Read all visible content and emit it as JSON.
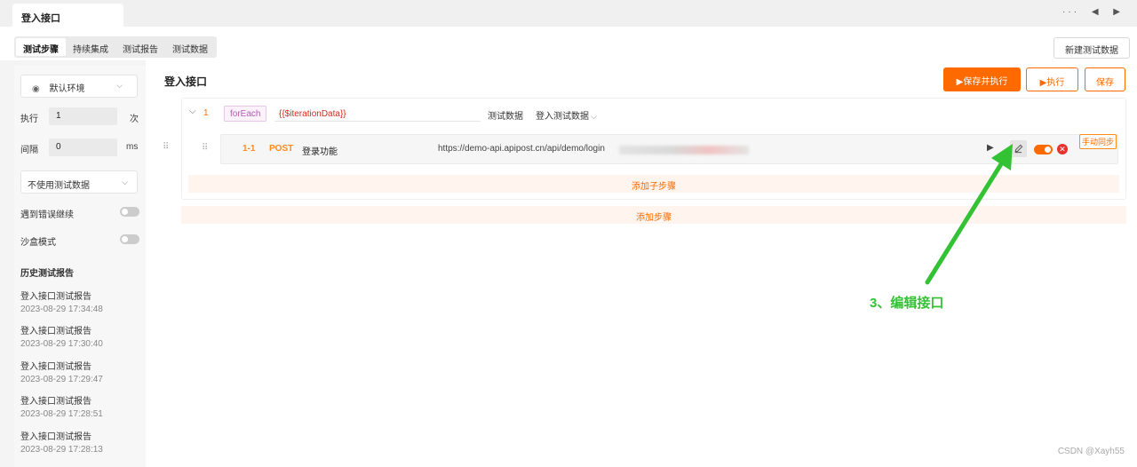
{
  "window_tab": {
    "title": "登入接口"
  },
  "tab_controls": {
    "more": "···",
    "prev": "◀",
    "next": "▶"
  },
  "subtabs": [
    {
      "label": "测试步骤",
      "active": true
    },
    {
      "label": "持续集成",
      "active": false
    },
    {
      "label": "测试报告",
      "active": false
    },
    {
      "label": "测试数据",
      "active": false
    }
  ],
  "new_test_data_button": "新建测试数据",
  "sidebar": {
    "env": {
      "value": "默认环境",
      "icon": "eye-icon"
    },
    "run_label": "执行",
    "run_value": "1",
    "run_unit": "次",
    "interval_label": "间隔",
    "interval_value": "0",
    "interval_unit": "ms",
    "data_select": "不使用测试数据",
    "continue_on_error": {
      "label": "遇到错误继续",
      "enabled": false
    },
    "sandbox": {
      "label": "沙盒模式",
      "enabled": false
    },
    "history_title": "历史测试报告",
    "history": [
      {
        "name": "登入接口测试报告",
        "date": "2023-08-29 17:34:48"
      },
      {
        "name": "登入接口测试报告",
        "date": "2023-08-29 17:30:40"
      },
      {
        "name": "登入接口测试报告",
        "date": "2023-08-29 17:29:47"
      },
      {
        "name": "登入接口测试报告",
        "date": "2023-08-29 17:28:51"
      },
      {
        "name": "登入接口测试报告",
        "date": "2023-08-29 17:28:13"
      }
    ]
  },
  "main": {
    "title": "登入接口",
    "buttons": {
      "run_and_save": "▶保存并执行",
      "run": "▶执行",
      "save": "保存"
    },
    "loop": {
      "index": "1",
      "tag": "forEach",
      "iteration": "{{$iterationData}}",
      "test_data_label": "测试数据",
      "test_data_value": "登入测试数据"
    },
    "step": {
      "index": "1-1",
      "method": "POST",
      "name": "登录功能",
      "url": "https://demo-api.apipost.cn/api/demo/login",
      "manual_sync": "手动同步"
    },
    "add_substep": "添加子步骤",
    "add_step": "添加步骤"
  },
  "annotation": {
    "text": "3、编辑接口",
    "color": "#33c233"
  },
  "watermark": "CSDN @Xayh55",
  "colors": {
    "accent": "#ff6a00",
    "danger": "#e5322d",
    "tag": "#b45db4"
  }
}
